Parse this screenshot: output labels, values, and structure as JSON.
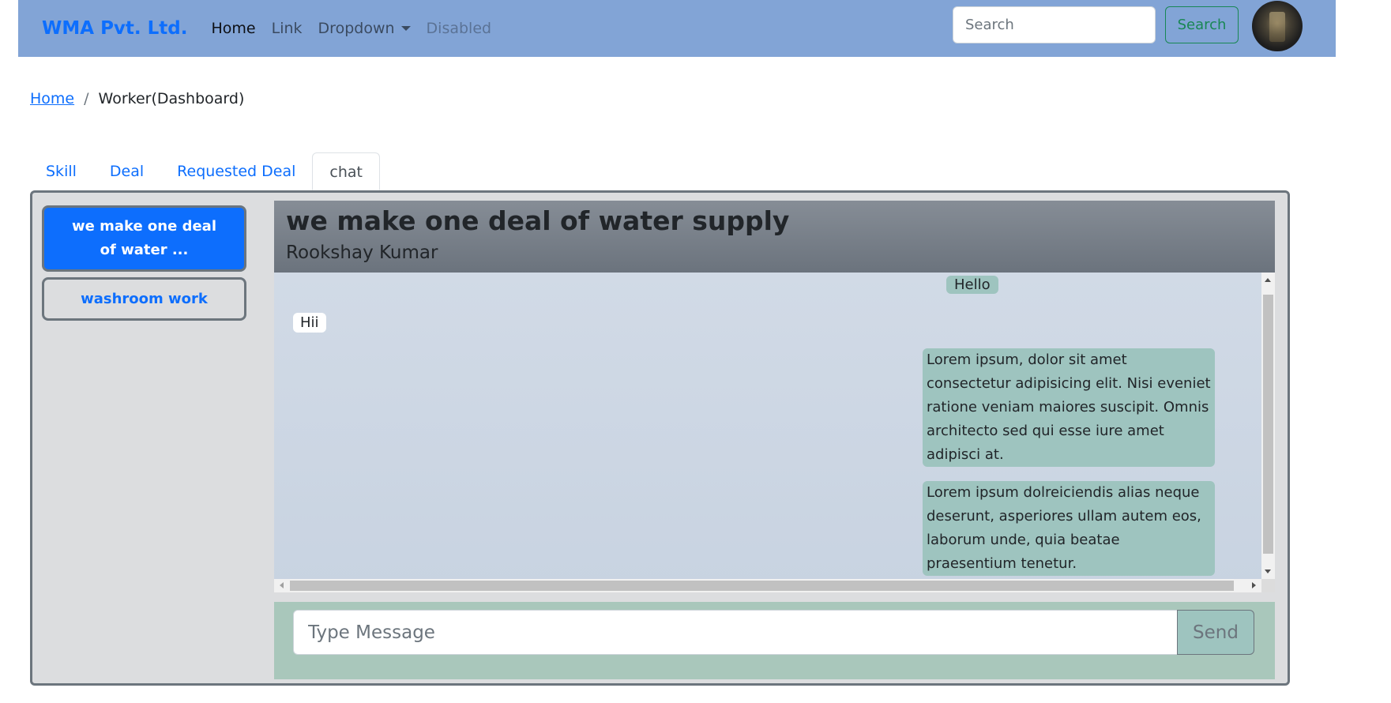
{
  "navbar": {
    "brand": "WMA Pvt. Ltd.",
    "links": [
      "Home",
      "Link",
      "Dropdown",
      "Disabled"
    ],
    "search_placeholder": "Search",
    "search_button": "Search"
  },
  "breadcrumb": {
    "home": "Home",
    "separator": "/",
    "current": "Worker(Dashboard)"
  },
  "tabs": [
    "Skill",
    "Deal",
    "Requested Deal",
    "chat"
  ],
  "active_tab": "chat",
  "deals": [
    "we make one deal of water ...",
    "washroom work"
  ],
  "chat": {
    "title": "we make one deal of water supply",
    "partner": "Rookshay Kumar",
    "messages": [
      {
        "text": "Hello",
        "side": "right"
      },
      {
        "text": "Hii",
        "side": "left"
      },
      {
        "text": "Lorem ipsum, dolor sit amet consectetur adipisicing elit. Nisi eveniet ratione veniam maiores suscipit. Omnis architecto sed qui esse iure amet adipisci at.",
        "side": "right"
      },
      {
        "text": "Lorem ipsum dolreiciendis alias neque deserunt, asperiores ullam autem eos, laborum unde, quia beatae praesentium tenetur.",
        "side": "right"
      }
    ],
    "input_placeholder": "Type Message",
    "send_label": "Send"
  },
  "colors": {
    "navbar_bg": "#82a4d6",
    "brand": "#0d6efd",
    "search_button": "#198754",
    "panel_bg": "#dcdddf",
    "own_bubble": "#9ec4bf",
    "other_bubble": "#ffffff",
    "composer_bg": "#a9c7bb"
  }
}
